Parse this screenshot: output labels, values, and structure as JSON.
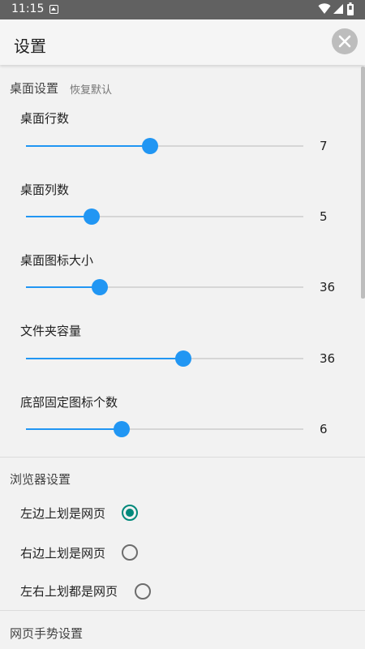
{
  "status_bar": {
    "time": "11:15",
    "icons": [
      "notification-icon",
      "wifi-icon",
      "cellular-icon",
      "battery-icon"
    ]
  },
  "app_bar": {
    "title": "设置",
    "close_icon": "close-icon"
  },
  "desktop_section": {
    "header": "桌面设置",
    "reset_label": "恢复默认",
    "items": [
      {
        "label": "桌面行数",
        "value": "7",
        "fraction": 0.447
      },
      {
        "label": "桌面列数",
        "value": "5",
        "fraction": 0.237
      },
      {
        "label": "桌面图标大小",
        "value": "36",
        "fraction": 0.266
      },
      {
        "label": "文件夹容量",
        "value": "36",
        "fraction": 0.567
      },
      {
        "label": "底部固定图标个数",
        "value": "6",
        "fraction": 0.345
      }
    ]
  },
  "browser_section": {
    "header": "浏览器设置",
    "options": [
      {
        "label": "左边上划是网页",
        "checked": true
      },
      {
        "label": "右边上划是网页",
        "checked": false
      },
      {
        "label": "左右上划都是网页",
        "checked": false
      }
    ]
  },
  "gesture_section": {
    "header": "网页手势设置"
  },
  "colors": {
    "accent_blue": "#2196f3",
    "radio_teal": "#00897b",
    "status_bar": "#616161"
  }
}
